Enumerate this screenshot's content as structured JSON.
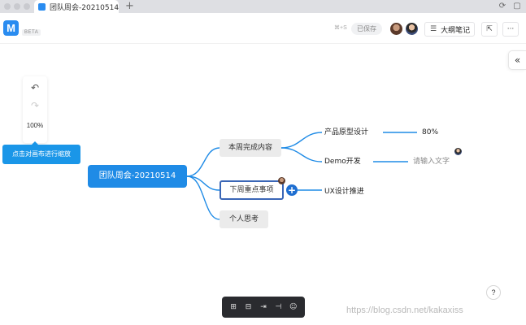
{
  "browser": {
    "tab_title": "团队周会-20210514",
    "new_tab_symbol": "+"
  },
  "header": {
    "logo_letter": "M",
    "beta_label": "BETA",
    "shortcut_hint": "⌘+S",
    "save_status": "已保存",
    "outline_button_label": "大纲笔记",
    "icons": {
      "outline": "outline-list-icon",
      "export": "export-icon",
      "more": "more-icon"
    }
  },
  "canvas": {
    "zoom_level": "100%",
    "tooltip": "点击对画布进行缩放"
  },
  "mindmap": {
    "root": "团队周会-20210514",
    "branches": [
      {
        "label": "本周完成内容"
      },
      {
        "label": "下周重点事项"
      },
      {
        "label": "个人思考"
      }
    ],
    "leaves": {
      "prototype": "产品原型设计",
      "progress": "80%",
      "demo": "Demo开发",
      "placeholder": "请输入文字",
      "ux": "UX设计推进"
    }
  },
  "toolbar": {
    "tools": [
      "add-sibling-icon",
      "add-child-icon",
      "insert-icon",
      "collapse-icon",
      "emoji-icon"
    ]
  },
  "help_symbol": "?",
  "watermark": "https://blog.csdn.net/kakaxiss",
  "colors": {
    "accent": "#1f8be6",
    "selected_border": "#3a66b6",
    "tooltip": "#1a96e8",
    "toolbar_bg": "#2a2b2f"
  }
}
